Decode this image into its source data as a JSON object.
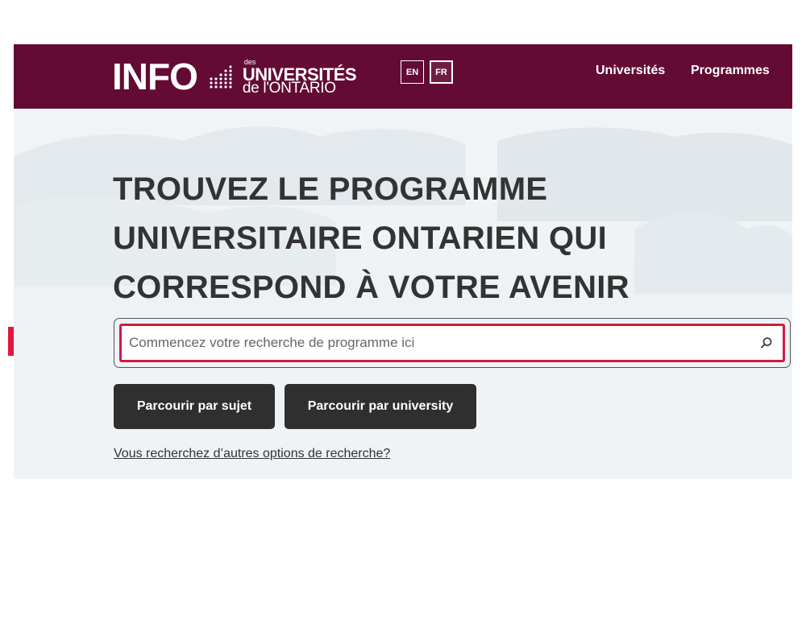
{
  "header": {
    "logo": {
      "info": "INFO",
      "des": "des",
      "universites": "UNIVERSITÉS",
      "ontario": "de l'ONTARIO"
    },
    "lang": {
      "en": "EN",
      "fr": "FR",
      "active": "FR"
    },
    "nav": {
      "universites": "Universités",
      "programmes": "Programmes"
    },
    "colors": {
      "header_bg": "#630b34",
      "text": "#ffffff"
    }
  },
  "hero": {
    "headline_line1": "TROUVEZ LE PROGRAMME",
    "headline_line2": "UNIVERSITAIRE ONTARIEN QUI",
    "headline_line3": "CORRESPOND À VOTRE AVENIR",
    "search": {
      "placeholder": "Commencez votre recherche de programme ici",
      "value": ""
    },
    "buttons": {
      "subject": "Parcourir par sujet",
      "university": "Parcourir par university"
    },
    "other_options_link": "Vous recherchez d’autres options de recherche?",
    "colors": {
      "highlight": "#d41a3e",
      "button_bg": "#2f2f2f",
      "headline": "#333333"
    }
  },
  "annotation": {
    "icon": "arrow-right-icon",
    "color": "#e3173e"
  }
}
